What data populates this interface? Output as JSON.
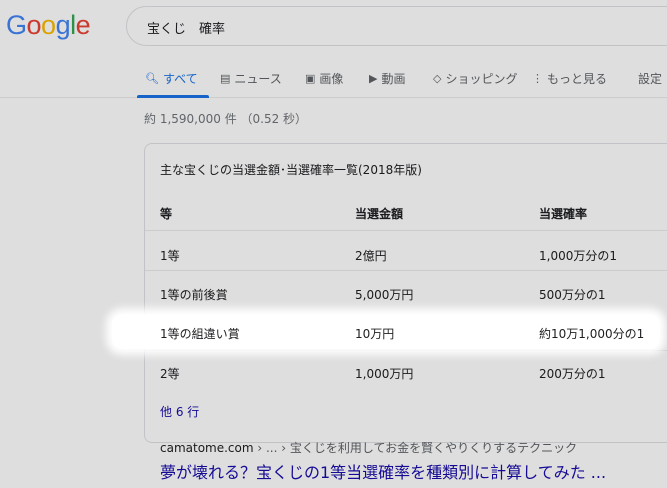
{
  "logo": {
    "letters": [
      "G",
      "o",
      "o",
      "g",
      "l",
      "e"
    ],
    "colors": [
      "#4285f4",
      "#ea4335",
      "#fbbc05",
      "#4285f4",
      "#34a853",
      "#ea4335"
    ]
  },
  "search": {
    "query": "宝くじ　確率"
  },
  "tabs": [
    {
      "label": "すべて",
      "icon": "search-icon",
      "active": true
    },
    {
      "label": "ニュース",
      "icon": "news-icon"
    },
    {
      "label": "画像",
      "icon": "image-icon"
    },
    {
      "label": "動画",
      "icon": "video-icon"
    },
    {
      "label": "ショッピング",
      "icon": "tag-icon"
    },
    {
      "label": "もっと見る",
      "icon": "more-vert-icon"
    },
    {
      "label": "設定"
    }
  ],
  "stats": "約 1,590,000 件 （0.52 秒）",
  "snippet": {
    "title": "主な宝くじの当選金額･当選確率一覧(2018年版)",
    "headers": [
      "等",
      "当選金額",
      "当選確率"
    ],
    "rows": [
      [
        "1等",
        "2億円",
        "1,000万分の1"
      ],
      [
        "1等の前後賞",
        "5,000万円",
        "500万分の1"
      ],
      [
        "1等の組違い賞",
        "10万円",
        "約10万1,000分の1"
      ],
      [
        "2等",
        "1,000万円",
        "200万分の1"
      ]
    ],
    "more_rows": "他 6 行"
  },
  "result": {
    "domain": "camatome.com",
    "path": " › ... › 宝くじを利用してお金を賢くやりくりするテクニック",
    "title": "夢が壊れる？宝くじの1等当選確率を種類別に計算してみた ..."
  },
  "colors": {
    "accent": "#1a73e8",
    "link": "#1a0dab",
    "muted": "#70757a"
  }
}
